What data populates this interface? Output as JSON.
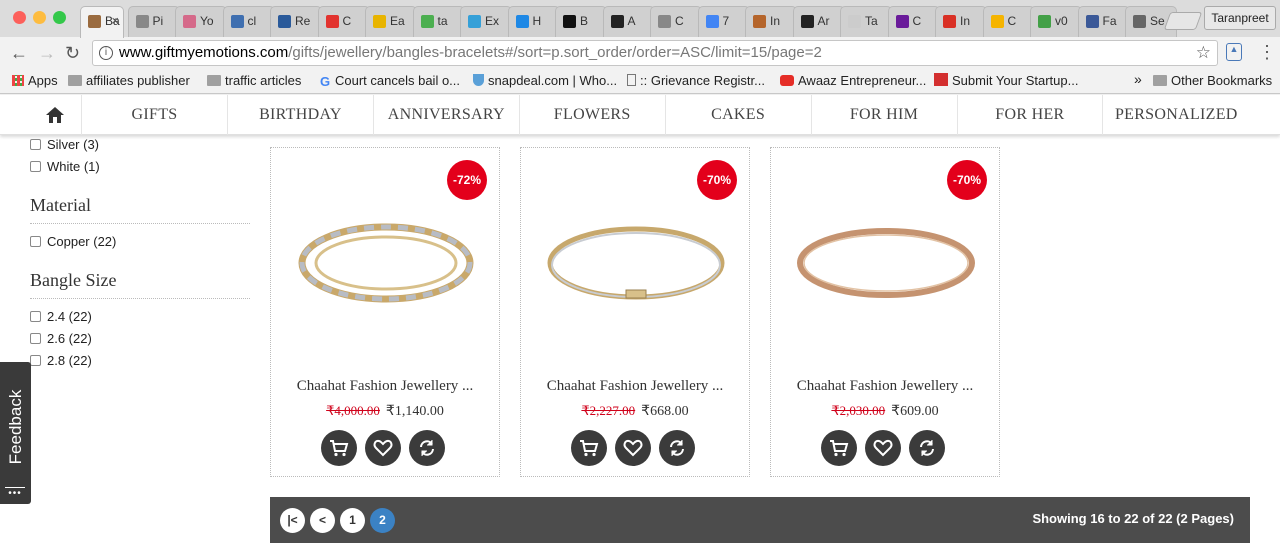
{
  "browser": {
    "tabs": [
      {
        "title": "Ba",
        "color": "#9a6b3f",
        "active": true
      },
      {
        "title": "Pi",
        "color": "#888888"
      },
      {
        "title": "Yo",
        "color": "#d56a8a"
      },
      {
        "title": "cl",
        "color": "#3f6fb0"
      },
      {
        "title": "Re",
        "color": "#2a5a9a"
      },
      {
        "title": "C",
        "color": "#e2332f"
      },
      {
        "title": "Ea",
        "color": "#e8b400"
      },
      {
        "title": "ta",
        "color": "#4caf50"
      },
      {
        "title": "Ex",
        "color": "#35a0d8"
      },
      {
        "title": "H",
        "color": "#1e88e5"
      },
      {
        "title": "B",
        "color": "#111111"
      },
      {
        "title": "A",
        "color": "#222222"
      },
      {
        "title": "C",
        "color": "#888888"
      },
      {
        "title": "7",
        "color": "#4285f4"
      },
      {
        "title": "In",
        "color": "#b5652b"
      },
      {
        "title": "Ar",
        "color": "#222222"
      },
      {
        "title": "Ta",
        "color": "#cccccc"
      },
      {
        "title": "C",
        "color": "#6a1b9a"
      },
      {
        "title": "In",
        "color": "#d93025"
      },
      {
        "title": "C",
        "color": "#f5b400"
      },
      {
        "title": "v0",
        "color": "#43a047"
      },
      {
        "title": "Fa",
        "color": "#3b5998"
      },
      {
        "title": "Se",
        "color": "#666666"
      }
    ],
    "profile_name": "Taranpreet",
    "url_host": "www.giftmyemotions.com",
    "url_path": "/gifts/jewellery/bangles-bracelets#/sort=p.sort_order/order=ASC/limit=15/page=2",
    "bookmarks": [
      {
        "label": "Apps",
        "type": "apps"
      },
      {
        "label": "affiliates publisher",
        "type": "folder"
      },
      {
        "label": "traffic articles",
        "type": "folder"
      },
      {
        "label": "Court cancels bail o...",
        "type": "google"
      },
      {
        "label": "snapdeal.com | Who...",
        "type": "shield"
      },
      {
        "label": ":: Grievance Registr...",
        "type": "page"
      },
      {
        "label": "Awaaz Entrepreneur...",
        "type": "youtube"
      },
      {
        "label": "Submit Your Startup...",
        "type": "42"
      }
    ],
    "more_bookmarks": "»",
    "other_bookmarks": "Other Bookmarks"
  },
  "nav": {
    "items": [
      "GIFTS",
      "BIRTHDAY",
      "ANNIVERSARY",
      "FLOWERS",
      "CAKES",
      "FOR HIM",
      "FOR HER",
      "PERSONALIZED"
    ]
  },
  "filters": {
    "color_options": [
      "Silver (3)",
      "White (1)"
    ],
    "material_heading": "Material",
    "material_options": [
      "Copper (22)"
    ],
    "bangle_size_heading": "Bangle Size",
    "bangle_size_options": [
      "2.4 (22)",
      "2.6 (22)",
      "2.8 (22)"
    ]
  },
  "feedback_label": "Feedback",
  "products": [
    {
      "name": "Chaahat Fashion Jewellery ...",
      "old_price": "₹4,000.00",
      "price": "₹1,140.00",
      "discount": "-72%",
      "style": "stone"
    },
    {
      "name": "Chaahat Fashion Jewellery ...",
      "old_price": "₹2,227.00",
      "price": "₹668.00",
      "discount": "-70%",
      "style": "silver"
    },
    {
      "name": "Chaahat Fashion Jewellery ...",
      "old_price": "₹2,030.00",
      "price": "₹609.00",
      "discount": "-70%",
      "style": "rose"
    }
  ],
  "pagination": {
    "first": "|<",
    "prev": "<",
    "pages": [
      "1",
      "2"
    ],
    "current": "2",
    "summary": "Showing 16 to 22 of 22 (2 Pages)"
  },
  "colors": {
    "badge": "#e3001b",
    "old_price": "#d0021b",
    "pager_bg": "#4c4c4c",
    "current_page": "#3b82c4"
  }
}
